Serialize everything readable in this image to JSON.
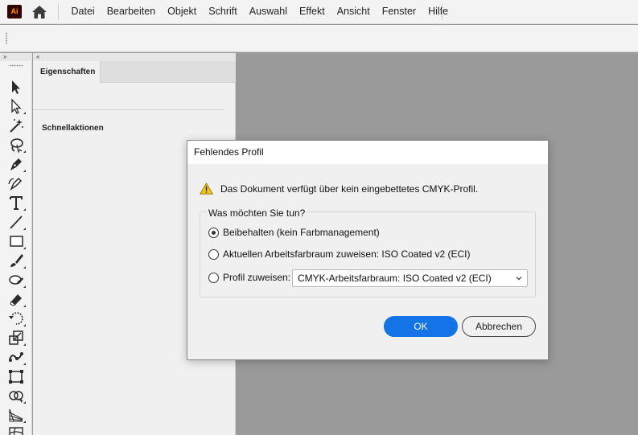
{
  "app": {
    "logo_text": "Ai",
    "menu": [
      "Datei",
      "Bearbeiten",
      "Objekt",
      "Schrift",
      "Auswahl",
      "Effekt",
      "Ansicht",
      "Fenster",
      "Hilfe"
    ]
  },
  "toolbar": {
    "collapse_glyph": "››",
    "tools": [
      "selection-tool",
      "direct-selection-tool",
      "magic-wand-tool",
      "lasso-tool",
      "pen-tool",
      "curvature-tool",
      "type-tool",
      "line-tool",
      "rectangle-tool",
      "paintbrush-tool",
      "shaper-tool",
      "eraser-tool",
      "rotate-tool",
      "scale-tool",
      "puppet-warp-tool",
      "free-transform-tool",
      "shape-builder-tool",
      "perspective-grid-tool",
      "mesh-tool"
    ]
  },
  "panel": {
    "collapse_glyph": "‹‹",
    "tab_label": "Eigenschaften",
    "section_label": "Schnellaktionen"
  },
  "dialog": {
    "title": "Fehlendes Profil",
    "message": "Das Dokument verfügt über kein eingebettetes CMYK-Profil.",
    "group_label": "Was möchten Sie tun?",
    "options": [
      {
        "label": "Beibehalten (kein Farbmanagement)",
        "checked": true
      },
      {
        "label": "Aktuellen Arbeitsfarbraum zuweisen: ISO Coated v2 (ECI)",
        "checked": false
      },
      {
        "label": "Profil zuweisen:",
        "checked": false
      }
    ],
    "profile_select_value": "CMYK-Arbeitsfarbraum: ISO Coated v2 (ECI)",
    "ok_label": "OK",
    "cancel_label": "Abbrechen"
  },
  "colors": {
    "accent": "#1473e6",
    "canvas": "#9a9a9a",
    "chrome": "#f3f3f3",
    "warning": "#f0c419"
  }
}
